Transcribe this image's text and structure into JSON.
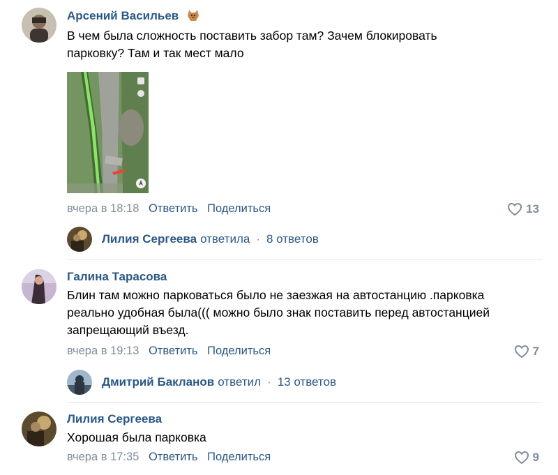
{
  "colors": {
    "link": "#2a5885",
    "meta": "#818c99",
    "divider": "#e7e8ec"
  },
  "comments": [
    {
      "author": "Арсений Васильев",
      "badge_icon": "cat-icon",
      "text_lines": [
        "В чем была сложность поставить забор там? Зачем блокировать",
        "парковку? Там и так мест мало"
      ],
      "has_image": true,
      "image_icon": "map-icon",
      "time": "вчера в 18:18",
      "reply_label": "Ответить",
      "share_label": "Поделиться",
      "likes": "13",
      "thread": {
        "name": "Лилия Сергеева",
        "verb": "ответила",
        "separator": "·",
        "count": "8 ответов"
      }
    },
    {
      "author": "Галина Тарасова",
      "text_lines": [
        "Блин там можно парковаться было не заезжая на автостанцию .парковка",
        "реально удобная была((( можно было знак поставить перед автостанцией",
        "запрещающий въезд."
      ],
      "time": "вчера в 19:13",
      "reply_label": "Ответить",
      "share_label": "Поделиться",
      "likes": "7",
      "thread": {
        "name": "Дмитрий Бакланов",
        "verb": "ответил",
        "separator": "·",
        "count": "13 ответов"
      }
    },
    {
      "author": "Лилия Сергеева",
      "text_lines": [
        "Хорошая была парковка"
      ],
      "time": "вчера в 17:35",
      "reply_label": "Ответить",
      "share_label": "Поделиться",
      "likes": "9"
    }
  ]
}
